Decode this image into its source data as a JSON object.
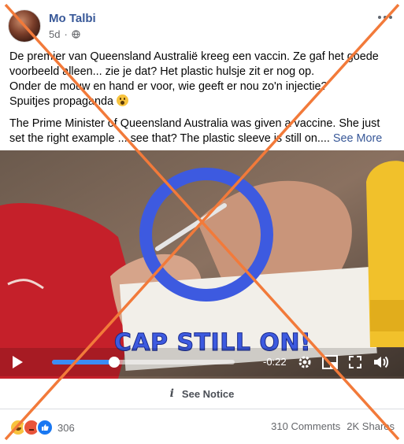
{
  "post": {
    "author": "Mo Talbi",
    "time": "5d",
    "privacy_icon": "globe-icon",
    "text_dutch_1": "De premier van Queensland Australië kreeg een vaccin. Ze gaf het goede voorbeeld alleen... zie je dat? Het plastic hulsje zit er nog op.",
    "text_dutch_2": "Onder de mouw en hand er voor, wie geeft er nou zo'n injectie?",
    "text_dutch_3": "Spuitjes propaganda",
    "text_english": "The Prime Minister of Queensland Australia was given a vaccine. She just set the right example ... see that? The plastic sleeve is still on....",
    "see_more": "See More"
  },
  "video": {
    "overlay_caption": "CAP STILL ON!",
    "time_remaining": "-0:22",
    "progress_fraction": 0.34,
    "accent": "#3b5bd6"
  },
  "notice": {
    "icon": "info-icon",
    "label": "See Notice"
  },
  "footer": {
    "reaction_count": "306",
    "comments": "310 Comments",
    "shares": "2K Shares"
  },
  "colors": {
    "cross": "#f27a3a",
    "link": "#385898",
    "ring": "#3d5ae0"
  }
}
